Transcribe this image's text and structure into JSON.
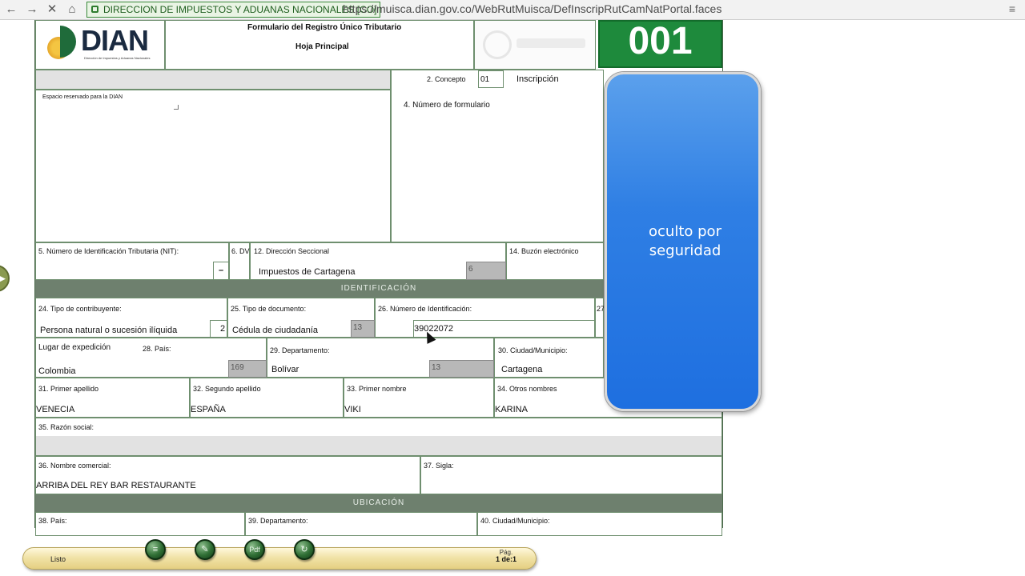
{
  "browser": {
    "back_icon": "←",
    "forward_icon": "→",
    "stop_icon": "✕",
    "home_icon": "⌂",
    "security_label": "DIRECCION DE IMPUESTOS Y ADUANAS NACIONALES [CO]",
    "url": "https://muisca.dian.gov.co/WebRutMuisca/DefInscripRutCamNatPortal.faces",
    "menu_icon": "≡"
  },
  "header": {
    "logo_text": "DIAN",
    "logo_sub": "Dirección de Impuestos y Aduanas Nacionales",
    "form_title": "Formulario del Registro Único Tributario",
    "form_subtitle": "Hoja Principal",
    "form_number": "001"
  },
  "top": {
    "reserved_label": "Espacio reservado para la DIAN",
    "concepto_label": "2. Concepto",
    "concepto_value": "01",
    "concepto_text": "Inscripción",
    "numero_formulario_label": "4. Número de formulario"
  },
  "row_nit": {
    "nit_label": "5. Número de Identificación Tributaria (NIT):",
    "dv_label": "6. DV",
    "dv_dash": "–",
    "seccional_label": "12. Dirección Seccional",
    "seccional_value": "Impuestos de Cartagena",
    "seccional_code": "6",
    "buzon_label": "14. Buzón electrónico"
  },
  "sections": {
    "identificacion": "IDENTIFICACIÓN",
    "ubicacion": "UBICACIÓN"
  },
  "identificacion": {
    "tipo_contribuyente_label": "24. Tipo de contribuyente:",
    "tipo_contribuyente_value": "Persona natural o sucesión ilíquida",
    "tipo_contribuyente_code": "2",
    "tipo_documento_label": "25. Tipo de documento:",
    "tipo_documento_value": "Cédula de ciudadanía",
    "tipo_documento_code": "13",
    "numero_id_label": "26. Número de Identificación:",
    "numero_id_value": "39022072",
    "col27_label": "27",
    "lugar_expedicion_label": "Lugar de expedición",
    "pais_label": "28. País:",
    "pais_value": "Colombia",
    "pais_code": "169",
    "departamento_label": "29. Departamento:",
    "departamento_value": "Bolívar",
    "departamento_code": "13",
    "ciudad_label": "30. Ciudad/Municipio:",
    "ciudad_value": "Cartagena",
    "primer_apellido_label": "31. Primer apellido",
    "primer_apellido_value": "VENECIA",
    "segundo_apellido_label": "32. Segundo apellido",
    "segundo_apellido_value": "ESPAÑA",
    "primer_nombre_label": "33. Primer nombre",
    "primer_nombre_value": "VIKI",
    "otros_nombres_label": "34. Otros nombres",
    "otros_nombres_value": "KARINA",
    "razon_social_label": "35. Razón social:",
    "nombre_comercial_label": "36. Nombre comercial:",
    "nombre_comercial_value": "ARRIBA DEL REY BAR RESTAURANTE",
    "sigla_label": "37. Sigla:"
  },
  "ubicacion": {
    "pais_label": "38. País:",
    "departamento_label": "39. Departamento:",
    "ciudad_label": "40. Ciudad/Municipio:"
  },
  "overlay": {
    "text_line1": "oculto por",
    "text_line2": "seguridad"
  },
  "statusbar": {
    "status": "Listo",
    "btn1_icon": "≡",
    "btn2_icon": "✎",
    "btn3_icon": "Pdf",
    "btn4_icon": "↻",
    "page_label": "Pág.",
    "page_value": "1 de:1"
  }
}
